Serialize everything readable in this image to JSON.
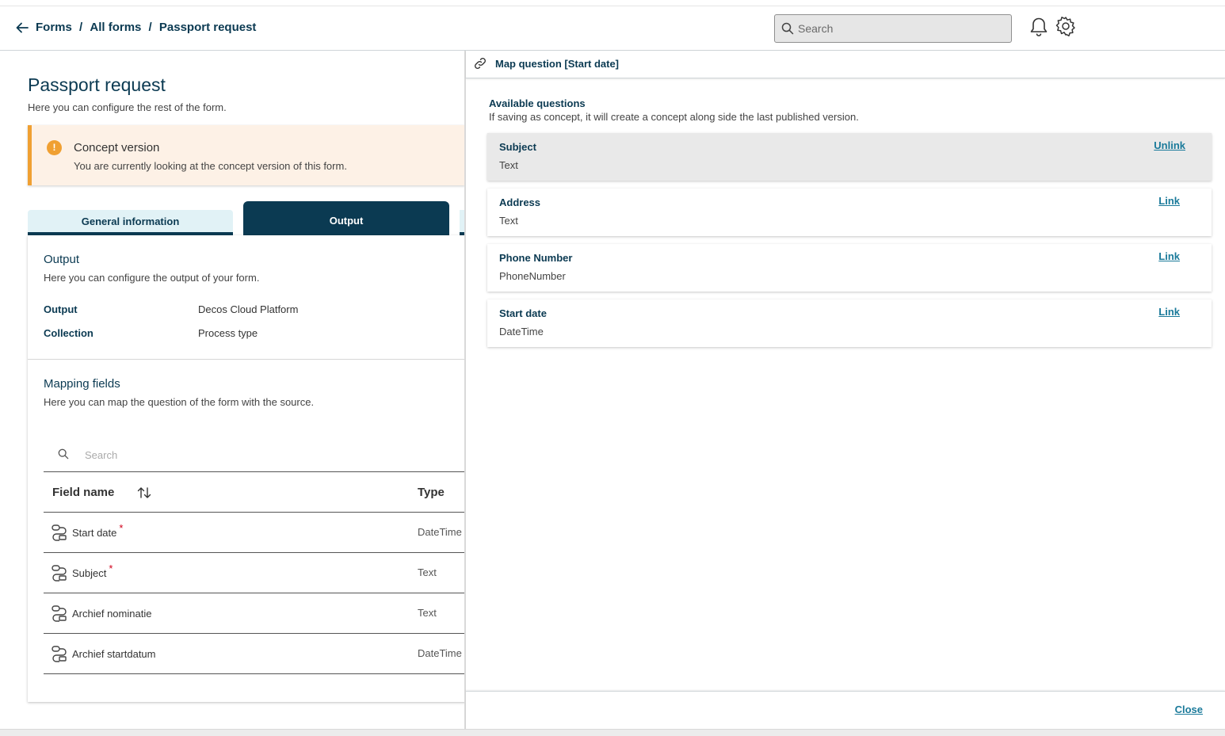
{
  "breadcrumb": {
    "items": [
      "Forms",
      "All forms",
      "Passport request"
    ],
    "separator": "/"
  },
  "top_search": {
    "placeholder": "Search"
  },
  "icons": {
    "back": "arrow-left-icon",
    "search": "search-icon",
    "bell": "bell-icon",
    "gear": "gear-icon",
    "link": "link-icon",
    "info": "info-icon",
    "sort": "sort-icon",
    "mapping": "mapping-icon"
  },
  "colors": {
    "primary": "#0b3a52",
    "accent": "#1a7a9a",
    "warning": "#f0a032",
    "warning_bg": "#fdf1e6",
    "tab_inactive": "#e1f2f6",
    "required": "#d0021b"
  },
  "page": {
    "title": "Passport request",
    "subtitle": "Here you can configure the rest of the form."
  },
  "concept": {
    "title": "Concept version",
    "description": "You are currently looking at the concept version of this form.",
    "icon_glyph": "!"
  },
  "tabs": [
    {
      "label": "General information",
      "active": false
    },
    {
      "label": "Output",
      "active": true
    }
  ],
  "output": {
    "title": "Output",
    "description": "Here you can configure the output of your form.",
    "rows": [
      {
        "key": "Output",
        "value": "Decos Cloud Platform"
      },
      {
        "key": "Collection",
        "value": "Process type"
      }
    ]
  },
  "mapping": {
    "title": "Mapping fields",
    "description": "Here you can map the question of the form with the source.",
    "search_placeholder": "Search",
    "columns": {
      "name": "Field name",
      "type": "Type"
    },
    "required_marker": "*",
    "rows": [
      {
        "name": "Start date",
        "required": true,
        "type": "DateTime"
      },
      {
        "name": "Subject",
        "required": true,
        "type": "Text"
      },
      {
        "name": "Archief nominatie",
        "required": false,
        "type": "Text"
      },
      {
        "name": "Archief startdatum",
        "required": false,
        "type": "DateTime"
      }
    ]
  },
  "panel": {
    "title": "Map question [Start date]",
    "available_title": "Available questions",
    "available_desc": "If saving as concept, it will create a concept along side the last published version.",
    "questions": [
      {
        "name": "Subject",
        "type": "Text",
        "action": "Unlink",
        "selected": true
      },
      {
        "name": "Address",
        "type": "Text",
        "action": "Link",
        "selected": false
      },
      {
        "name": "Phone Number",
        "type": "PhoneNumber",
        "action": "Link",
        "selected": false
      },
      {
        "name": "Start date",
        "type": "DateTime",
        "action": "Link",
        "selected": false
      }
    ],
    "close_label": "Close"
  }
}
